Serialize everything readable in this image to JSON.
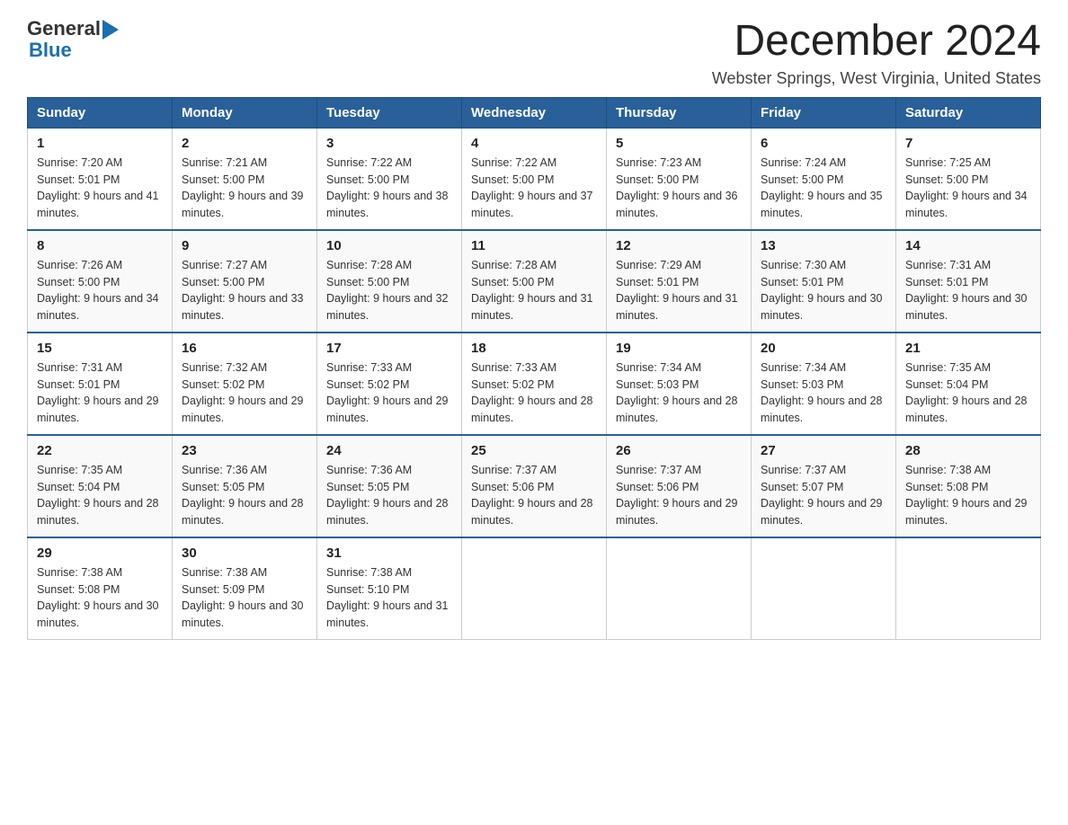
{
  "header": {
    "logo_general": "General",
    "logo_blue": "Blue",
    "month_title": "December 2024",
    "location": "Webster Springs, West Virginia, United States"
  },
  "days_of_week": [
    "Sunday",
    "Monday",
    "Tuesday",
    "Wednesday",
    "Thursday",
    "Friday",
    "Saturday"
  ],
  "weeks": [
    [
      {
        "day": "1",
        "sunrise": "7:20 AM",
        "sunset": "5:01 PM",
        "daylight": "9 hours and 41 minutes."
      },
      {
        "day": "2",
        "sunrise": "7:21 AM",
        "sunset": "5:00 PM",
        "daylight": "9 hours and 39 minutes."
      },
      {
        "day": "3",
        "sunrise": "7:22 AM",
        "sunset": "5:00 PM",
        "daylight": "9 hours and 38 minutes."
      },
      {
        "day": "4",
        "sunrise": "7:22 AM",
        "sunset": "5:00 PM",
        "daylight": "9 hours and 37 minutes."
      },
      {
        "day": "5",
        "sunrise": "7:23 AM",
        "sunset": "5:00 PM",
        "daylight": "9 hours and 36 minutes."
      },
      {
        "day": "6",
        "sunrise": "7:24 AM",
        "sunset": "5:00 PM",
        "daylight": "9 hours and 35 minutes."
      },
      {
        "day": "7",
        "sunrise": "7:25 AM",
        "sunset": "5:00 PM",
        "daylight": "9 hours and 34 minutes."
      }
    ],
    [
      {
        "day": "8",
        "sunrise": "7:26 AM",
        "sunset": "5:00 PM",
        "daylight": "9 hours and 34 minutes."
      },
      {
        "day": "9",
        "sunrise": "7:27 AM",
        "sunset": "5:00 PM",
        "daylight": "9 hours and 33 minutes."
      },
      {
        "day": "10",
        "sunrise": "7:28 AM",
        "sunset": "5:00 PM",
        "daylight": "9 hours and 32 minutes."
      },
      {
        "day": "11",
        "sunrise": "7:28 AM",
        "sunset": "5:00 PM",
        "daylight": "9 hours and 31 minutes."
      },
      {
        "day": "12",
        "sunrise": "7:29 AM",
        "sunset": "5:01 PM",
        "daylight": "9 hours and 31 minutes."
      },
      {
        "day": "13",
        "sunrise": "7:30 AM",
        "sunset": "5:01 PM",
        "daylight": "9 hours and 30 minutes."
      },
      {
        "day": "14",
        "sunrise": "7:31 AM",
        "sunset": "5:01 PM",
        "daylight": "9 hours and 30 minutes."
      }
    ],
    [
      {
        "day": "15",
        "sunrise": "7:31 AM",
        "sunset": "5:01 PM",
        "daylight": "9 hours and 29 minutes."
      },
      {
        "day": "16",
        "sunrise": "7:32 AM",
        "sunset": "5:02 PM",
        "daylight": "9 hours and 29 minutes."
      },
      {
        "day": "17",
        "sunrise": "7:33 AM",
        "sunset": "5:02 PM",
        "daylight": "9 hours and 29 minutes."
      },
      {
        "day": "18",
        "sunrise": "7:33 AM",
        "sunset": "5:02 PM",
        "daylight": "9 hours and 28 minutes."
      },
      {
        "day": "19",
        "sunrise": "7:34 AM",
        "sunset": "5:03 PM",
        "daylight": "9 hours and 28 minutes."
      },
      {
        "day": "20",
        "sunrise": "7:34 AM",
        "sunset": "5:03 PM",
        "daylight": "9 hours and 28 minutes."
      },
      {
        "day": "21",
        "sunrise": "7:35 AM",
        "sunset": "5:04 PM",
        "daylight": "9 hours and 28 minutes."
      }
    ],
    [
      {
        "day": "22",
        "sunrise": "7:35 AM",
        "sunset": "5:04 PM",
        "daylight": "9 hours and 28 minutes."
      },
      {
        "day": "23",
        "sunrise": "7:36 AM",
        "sunset": "5:05 PM",
        "daylight": "9 hours and 28 minutes."
      },
      {
        "day": "24",
        "sunrise": "7:36 AM",
        "sunset": "5:05 PM",
        "daylight": "9 hours and 28 minutes."
      },
      {
        "day": "25",
        "sunrise": "7:37 AM",
        "sunset": "5:06 PM",
        "daylight": "9 hours and 28 minutes."
      },
      {
        "day": "26",
        "sunrise": "7:37 AM",
        "sunset": "5:06 PM",
        "daylight": "9 hours and 29 minutes."
      },
      {
        "day": "27",
        "sunrise": "7:37 AM",
        "sunset": "5:07 PM",
        "daylight": "9 hours and 29 minutes."
      },
      {
        "day": "28",
        "sunrise": "7:38 AM",
        "sunset": "5:08 PM",
        "daylight": "9 hours and 29 minutes."
      }
    ],
    [
      {
        "day": "29",
        "sunrise": "7:38 AM",
        "sunset": "5:08 PM",
        "daylight": "9 hours and 30 minutes."
      },
      {
        "day": "30",
        "sunrise": "7:38 AM",
        "sunset": "5:09 PM",
        "daylight": "9 hours and 30 minutes."
      },
      {
        "day": "31",
        "sunrise": "7:38 AM",
        "sunset": "5:10 PM",
        "daylight": "9 hours and 31 minutes."
      },
      null,
      null,
      null,
      null
    ]
  ]
}
